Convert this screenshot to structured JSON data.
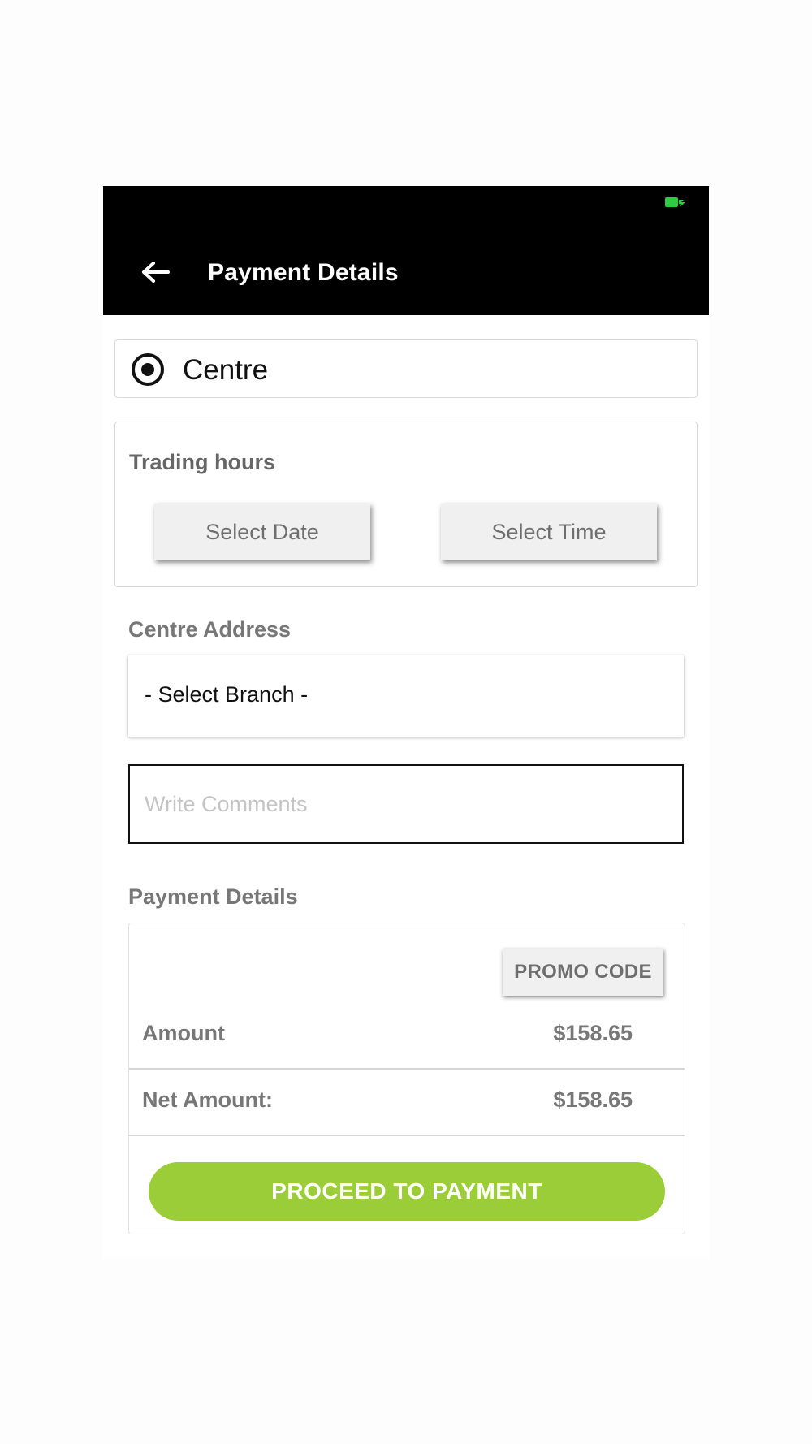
{
  "header": {
    "title": "Payment Details",
    "back_icon": "arrow-left-icon",
    "battery_icon": "battery-charging-icon",
    "battery_color": "#2ecc40"
  },
  "delivery_option": {
    "label": "Centre",
    "selected": true
  },
  "trading_hours": {
    "label": "Trading hours",
    "select_date_label": "Select Date",
    "select_time_label": "Select Time"
  },
  "centre_address": {
    "label": "Centre Address",
    "branch_select_value": "- Select Branch -"
  },
  "comments": {
    "placeholder": "Write Comments",
    "value": ""
  },
  "payment": {
    "label": "Payment Details",
    "promo_label": "PROMO CODE",
    "amount_label": "Amount",
    "amount_value": "$158.65",
    "net_label": "Net Amount:",
    "net_value": "$158.65",
    "proceed_label": "PROCEED TO PAYMENT",
    "accent_color": "#9acd37"
  }
}
